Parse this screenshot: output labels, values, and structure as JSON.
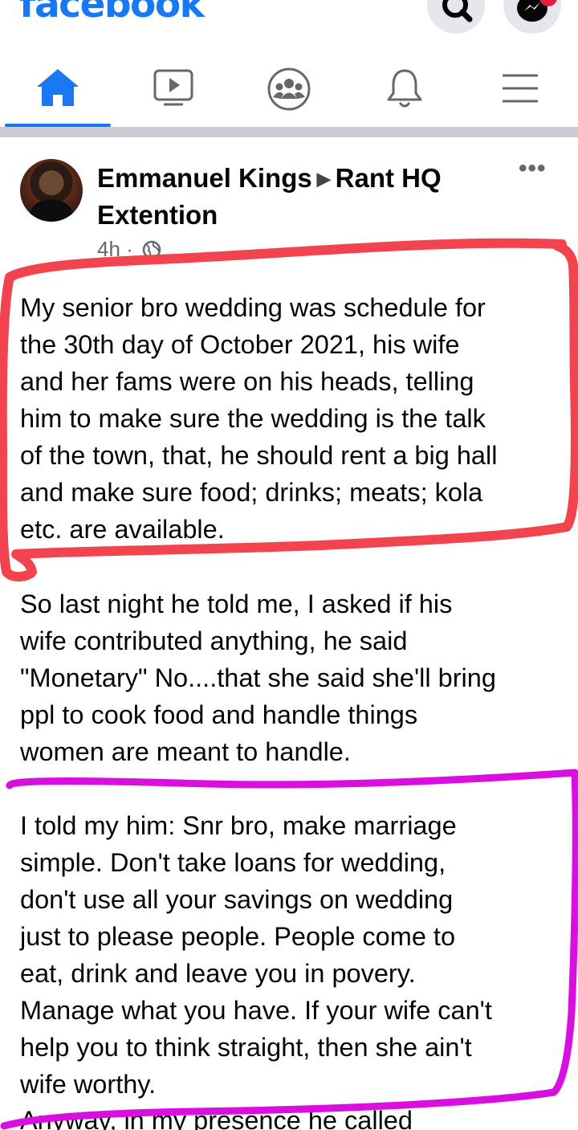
{
  "header": {
    "app_name": "facebook",
    "icons": [
      "search-icon",
      "messenger-icon"
    ],
    "brand_color": "#1877f2"
  },
  "nav": {
    "tabs": [
      {
        "name": "home",
        "icon": "home-icon",
        "active": true
      },
      {
        "name": "watch",
        "icon": "video-icon",
        "active": false
      },
      {
        "name": "groups",
        "icon": "groups-icon",
        "active": false
      },
      {
        "name": "notifications",
        "icon": "bell-icon",
        "active": false
      },
      {
        "name": "menu",
        "icon": "hamburger-menu-icon",
        "active": false
      }
    ]
  },
  "post": {
    "author": "Emmanuel Kings",
    "group": "Rant HQ Extention",
    "time": "4h",
    "audience_icon": "globe-icon",
    "paragraphs": [
      "My senior bro wedding was schedule for\nthe 30th day of October 2021, his wife\nand her fams were on his heads, telling\nhim to make sure the wedding is the talk\nof the town, that, he should rent a big hall\nand make sure food; drinks; meats; kola\netc. are available.",
      "So last night he told me, I asked if his\nwife contributed anything, he said\n\"Monetary\" No....that she said she'll bring\nppl to cook food and handle things\nwomen are meant to handle.",
      "I told my him: Snr bro, make marriage\nsimple. Don't take loans for wedding,\ndon't use all your savings on wedding\njust to please people. People come to\neat, drink and leave you in povery.\nManage what you have. If your wife can't\nhelp you to think straight, then she ain't\nwife worthy.",
      "Anyway, in my presence he called"
    ]
  },
  "annotations": {
    "red_marker_color": "#f2444e",
    "magenta_marker_color": "#d90fe0"
  }
}
